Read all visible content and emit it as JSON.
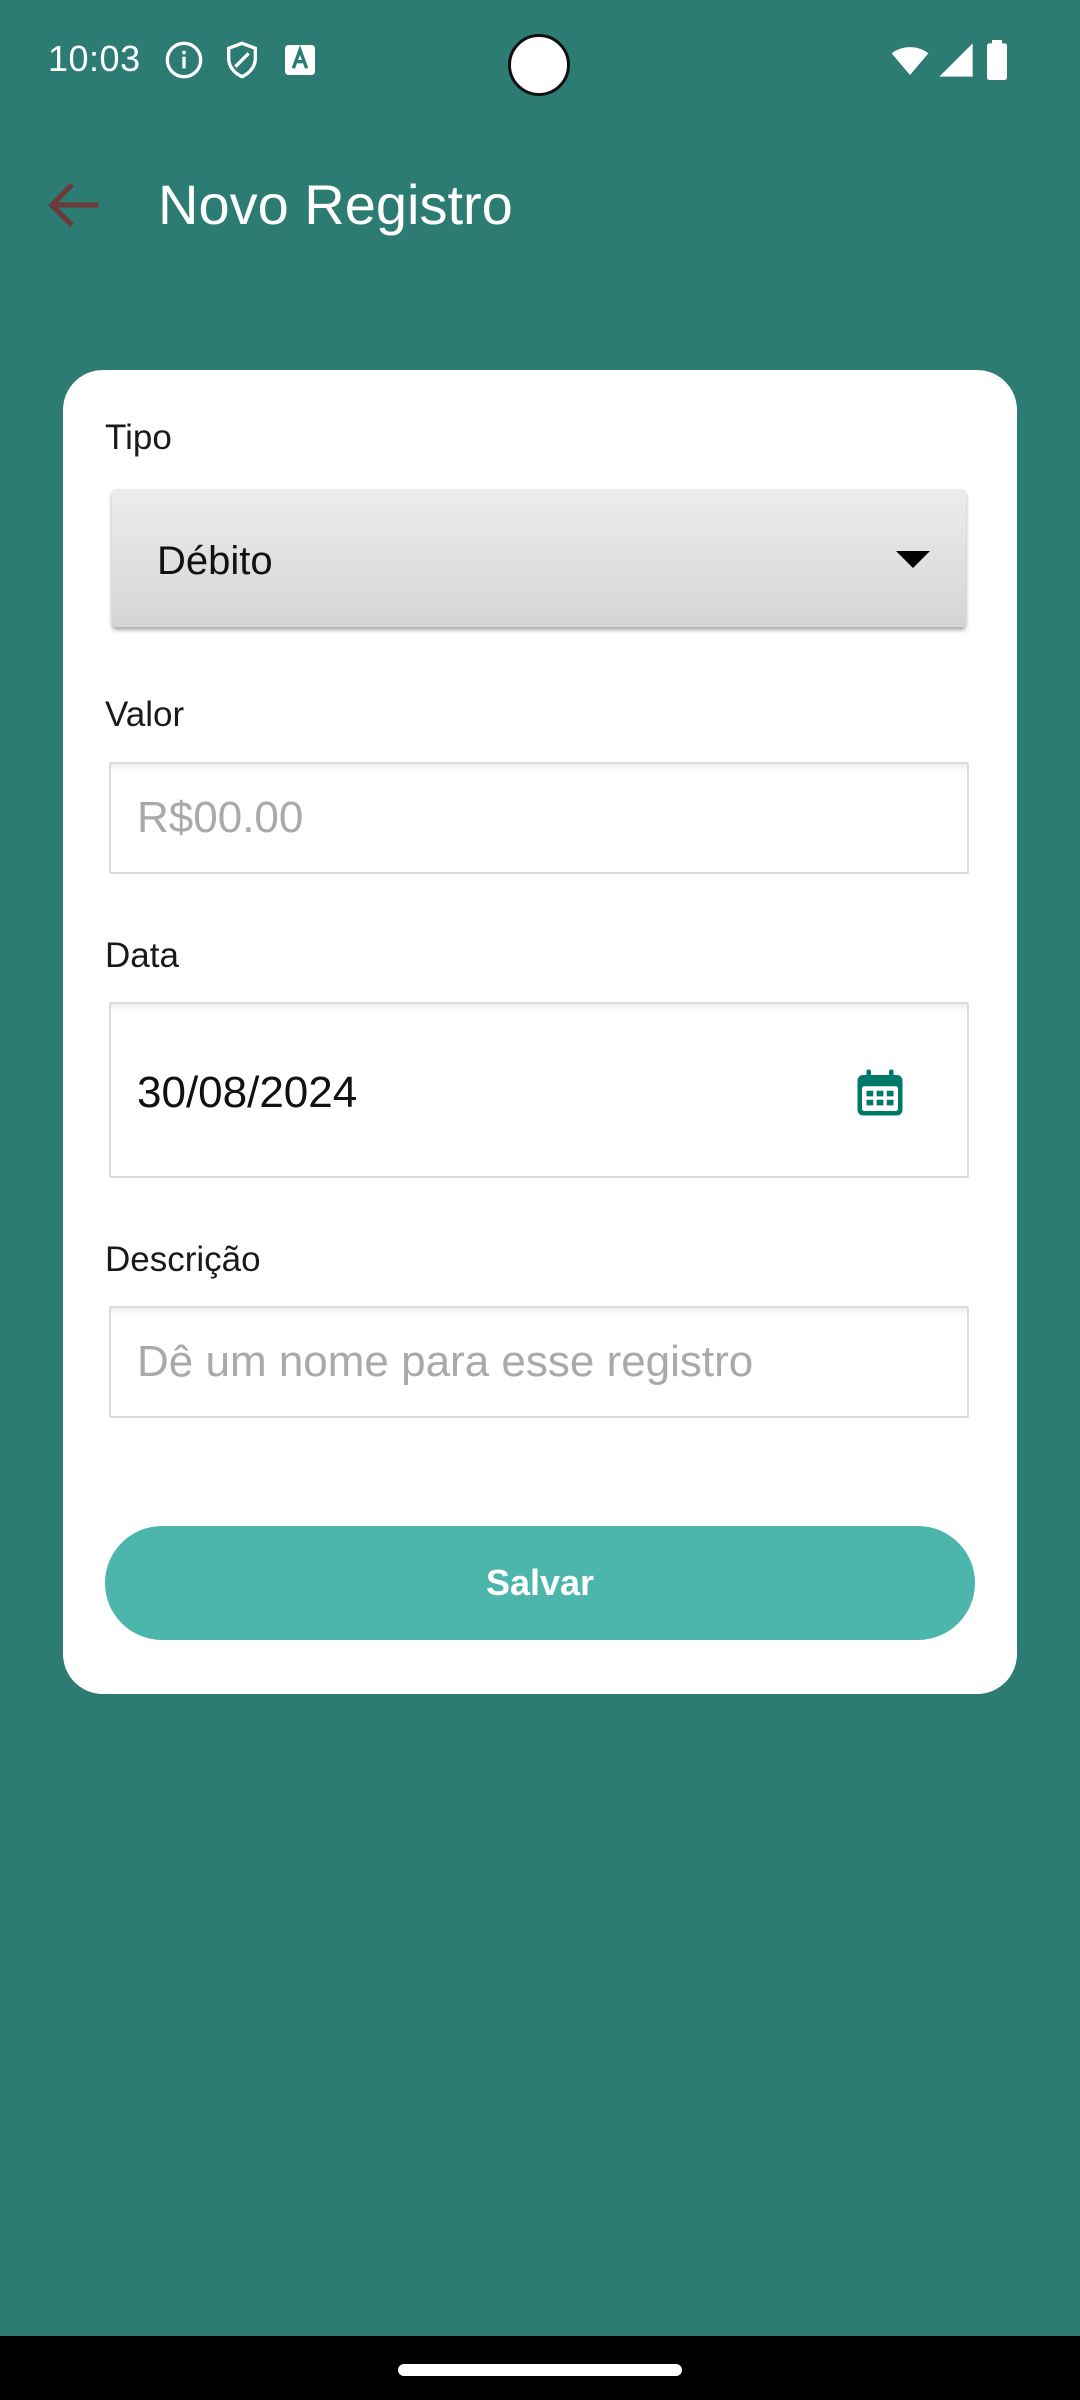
{
  "status_bar": {
    "time": "10:03",
    "icons": [
      "info-icon",
      "shield-icon",
      "text-a-icon",
      "wifi-icon",
      "signal-icon",
      "battery-icon"
    ]
  },
  "app_bar": {
    "title": "Novo Registro",
    "back_icon": "arrow-back-icon"
  },
  "form": {
    "type": {
      "label": "Tipo",
      "selected": "Débito"
    },
    "amount": {
      "label": "Valor",
      "value": "",
      "placeholder": "R$00.00"
    },
    "date": {
      "label": "Data",
      "value": "30/08/2024",
      "icon": "calendar-icon"
    },
    "description": {
      "label": "Descrição",
      "value": "",
      "placeholder": "Dê um nome para esse registro"
    },
    "save_label": "Salvar"
  },
  "colors": {
    "background": "#2C7C74",
    "card": "#FFFFFF",
    "accent": "#4DB6AC",
    "calendar_icon": "#00796B",
    "back_arrow": "#6B3B3B"
  }
}
